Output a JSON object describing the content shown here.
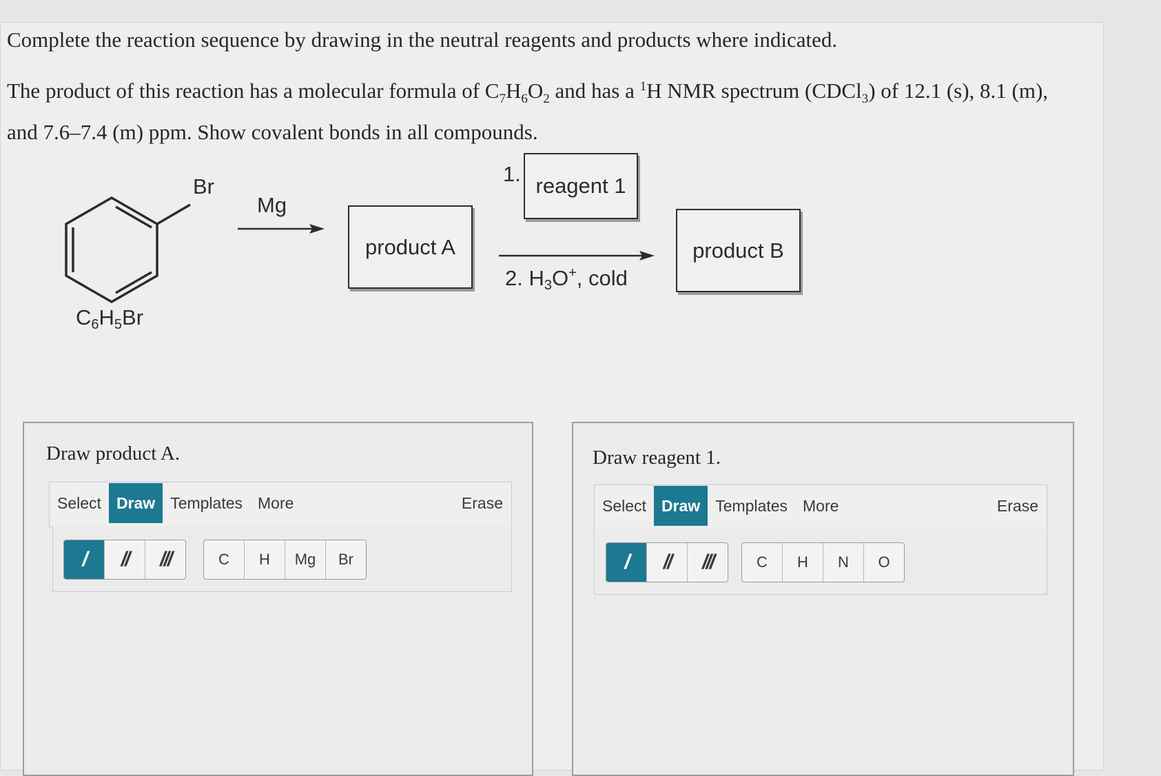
{
  "question": {
    "line1": "Complete the reaction sequence by drawing in the neutral reagents and products where indicated.",
    "line2_a": "The product of this reaction has a molecular formula of C",
    "formula_c": "7",
    "formula_h_label": "H",
    "formula_h": "6",
    "formula_o_label": "O",
    "formula_o": "2",
    "line2_b": " and has a ",
    "nmr_sup": "1",
    "line2_c": "H NMR spectrum (CDCl",
    "cdcl_sub": "3",
    "line2_d": ") of 12.1 (s), 8.1 (m), and 7.6–7.4 (m) ppm. Show covalent bonds in all compounds."
  },
  "scheme": {
    "substituent": "Br",
    "start_formula_c": "C",
    "start_formula_6": "6",
    "start_formula_h": "H",
    "start_formula_5": "5",
    "start_formula_br": "Br",
    "step1_reagent": "Mg",
    "product_a": "product A",
    "step2_num1": "1.",
    "reagent_1": "reagent 1",
    "step2_line2_a": "2. H",
    "step2_h3o_sub": "3",
    "step2_h3o_o": "O",
    "step2_h3o_sup": "+",
    "step2_line2_b": ", cold",
    "product_b": "product B"
  },
  "panel_a": {
    "title": "Draw product A.",
    "tabs": [
      "Select",
      "Draw",
      "Templates",
      "More"
    ],
    "active_tab": "Draw",
    "erase": "Erase",
    "bonds": [
      "/",
      "//",
      "///"
    ],
    "atoms": [
      "C",
      "H",
      "Mg",
      "Br"
    ]
  },
  "panel_b": {
    "title": "Draw reagent 1.",
    "tabs": [
      "Select",
      "Draw",
      "Templates",
      "More"
    ],
    "active_tab": "Draw",
    "erase": "Erase",
    "bonds": [
      "/",
      "//",
      "///"
    ],
    "atoms": [
      "C",
      "H",
      "N",
      "O"
    ]
  },
  "colors": {
    "accent": "#1d7891",
    "box_border": "#2e2e2e"
  }
}
